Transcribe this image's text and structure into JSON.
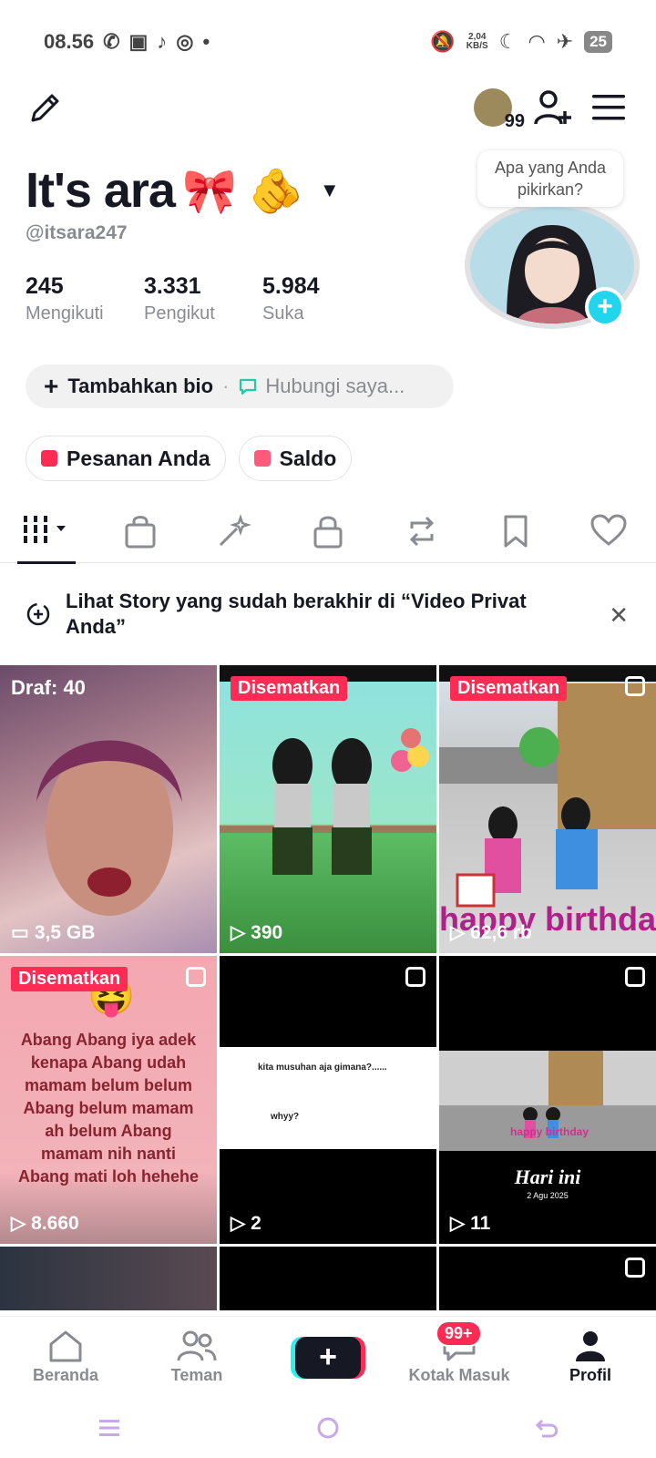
{
  "status_bar": {
    "time": "08.56",
    "speed_value": "2,04",
    "speed_unit": "KB/S",
    "battery": "25"
  },
  "header": {
    "friends_count": "99"
  },
  "profile": {
    "display_name": "It's ara",
    "name_emoji": "🎀 🫵",
    "username": "@itsara247",
    "stats": [
      {
        "value": "245",
        "label": "Mengikuti"
      },
      {
        "value": "3.331",
        "label": "Pengikut"
      },
      {
        "value": "5.984",
        "label": "Suka"
      }
    ],
    "thought_bubble": "Apa yang Anda pikirkan?",
    "add_bio": "Tambahkan bio",
    "contact": "Hubungi saya..."
  },
  "pills": {
    "orders": "Pesanan Anda",
    "balance": "Saldo"
  },
  "tabs": [
    "videos",
    "shop",
    "reposts-sparkle",
    "private",
    "repost",
    "favorites",
    "liked"
  ],
  "story_banner": {
    "text": "Lihat Story yang sudah berakhir di “Video Privat Anda”"
  },
  "grid": {
    "cells": [
      {
        "draft": "Draf: 40",
        "views": "3,5 GB"
      },
      {
        "pin": "Disematkan",
        "views": "390"
      },
      {
        "pin": "Disematkan",
        "views": "62,6 rb"
      },
      {
        "pin": "Disematkan",
        "views": "8.660",
        "caption": "Abang Abang iya adek kenapa Abang udah mamam belum belum Abang belum mamam ah belum Abang mamam nih nanti Abang mati loh hehehe"
      },
      {
        "views": "2",
        "comment_1": "kita musuhan aja gimana?......",
        "comment_2": "whyy?"
      },
      {
        "views": "11",
        "date_title": "Hari ini",
        "date_sub": "2 Agu 2025",
        "overlay": "happy birthday"
      }
    ],
    "cell3_overlay": "happy birthda"
  },
  "bottom_nav": {
    "home": "Beranda",
    "friends": "Teman",
    "inbox": "Kotak Masuk",
    "inbox_badge": "99+",
    "profile": "Profil"
  },
  "colors": {
    "brand_red": "#fe2c55",
    "brand_cyan": "#25f4ee",
    "text_primary": "#161823",
    "text_secondary": "#8a8b91"
  }
}
